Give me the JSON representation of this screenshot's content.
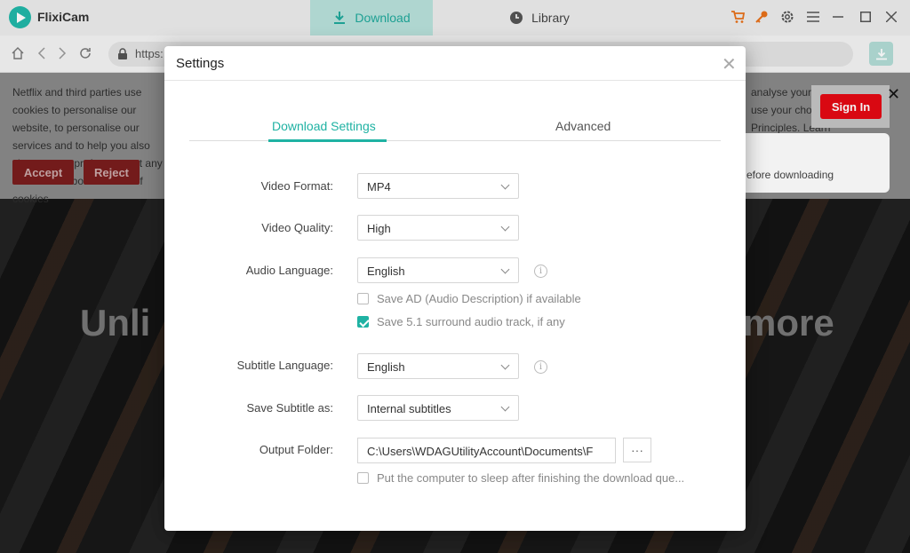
{
  "app": {
    "name": "FlixiCam"
  },
  "topbar": {
    "tabs": [
      {
        "label": "Download",
        "icon": "download-icon",
        "active": true
      },
      {
        "label": "Library",
        "icon": "clock-icon",
        "active": false
      }
    ],
    "icons": [
      "cart-icon",
      "key-icon",
      "gear-icon",
      "menu-icon",
      "minimize-icon",
      "maximize-icon",
      "close-icon"
    ],
    "accent_color": "#1fb2a3",
    "icon_color_orange": "#e8711a"
  },
  "addressbar": {
    "url": "https:"
  },
  "background": {
    "cookie_text": "Netflix and third parties use cookies to personalise our website, to personalise our services and to help you also change your preferences at any time. more about our use of cookies",
    "cookie_text_right": "analyse your use of the use your choices. ance Principles. Learn",
    "accept_label": "Accept",
    "reject_label": "Reject",
    "hero_left": "Unli",
    "hero_right": "more",
    "signin_label": "Sign In",
    "tip_text": "efore downloading"
  },
  "dialog": {
    "title": "Settings",
    "tabs": [
      {
        "label": "Download Settings",
        "active": true
      },
      {
        "label": "Advanced",
        "active": false
      }
    ],
    "video_format": {
      "label": "Video Format:",
      "value": "MP4"
    },
    "video_quality": {
      "label": "Video Quality:",
      "value": "High"
    },
    "audio_language": {
      "label": "Audio Language:",
      "value": "English"
    },
    "save_ad": {
      "label": "Save AD (Audio Description) if available",
      "checked": false
    },
    "save_51": {
      "label": "Save 5.1 surround audio track, if any",
      "checked": true
    },
    "subtitle_language": {
      "label": "Subtitle Language:",
      "value": "English"
    },
    "save_subtitle_as": {
      "label": "Save Subtitle as:",
      "value": "Internal subtitles"
    },
    "output_folder": {
      "label": "Output Folder:",
      "value": "C:\\Users\\WDAGUtilityAccount\\Documents\\F",
      "more": "···"
    },
    "sleep": {
      "label": "Put the computer to sleep after finishing the download que...",
      "checked": false
    }
  }
}
